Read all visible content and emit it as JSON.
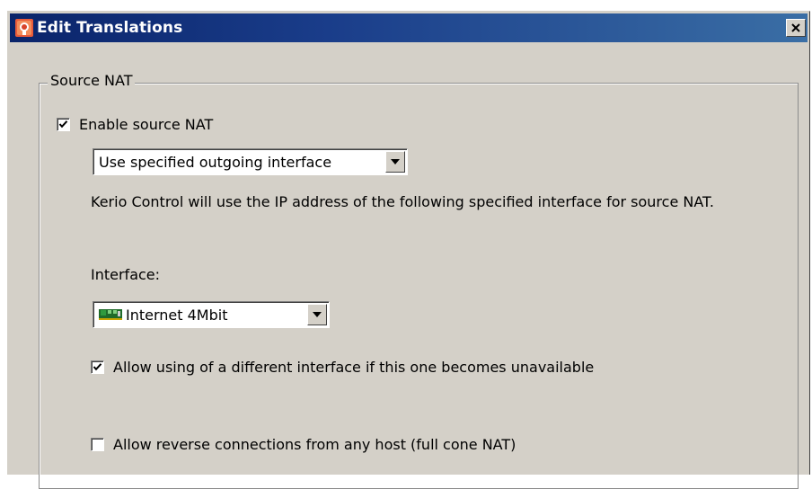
{
  "window": {
    "title": "Edit Translations"
  },
  "source_nat": {
    "group_label": "Source NAT",
    "enable_label": "Enable source NAT",
    "enable_checked": true,
    "mode_selected": "Use specified outgoing interface",
    "description": "Kerio Control will use the IP address of the following specified interface for source NAT.",
    "interface_label": "Interface:",
    "interface_selected": "Internet 4Mbit",
    "allow_different_label": "Allow using of a different interface if this one becomes unavailable",
    "allow_different_checked": true,
    "allow_reverse_label": "Allow reverse connections from any host (full cone NAT)",
    "allow_reverse_checked": false
  },
  "colors": {
    "titlebar": "#0a246a",
    "dialog_bg": "#d4d0c8"
  },
  "icons": {
    "app": "kerio-app-icon",
    "close": "close-icon",
    "interface": "network-card-icon"
  }
}
